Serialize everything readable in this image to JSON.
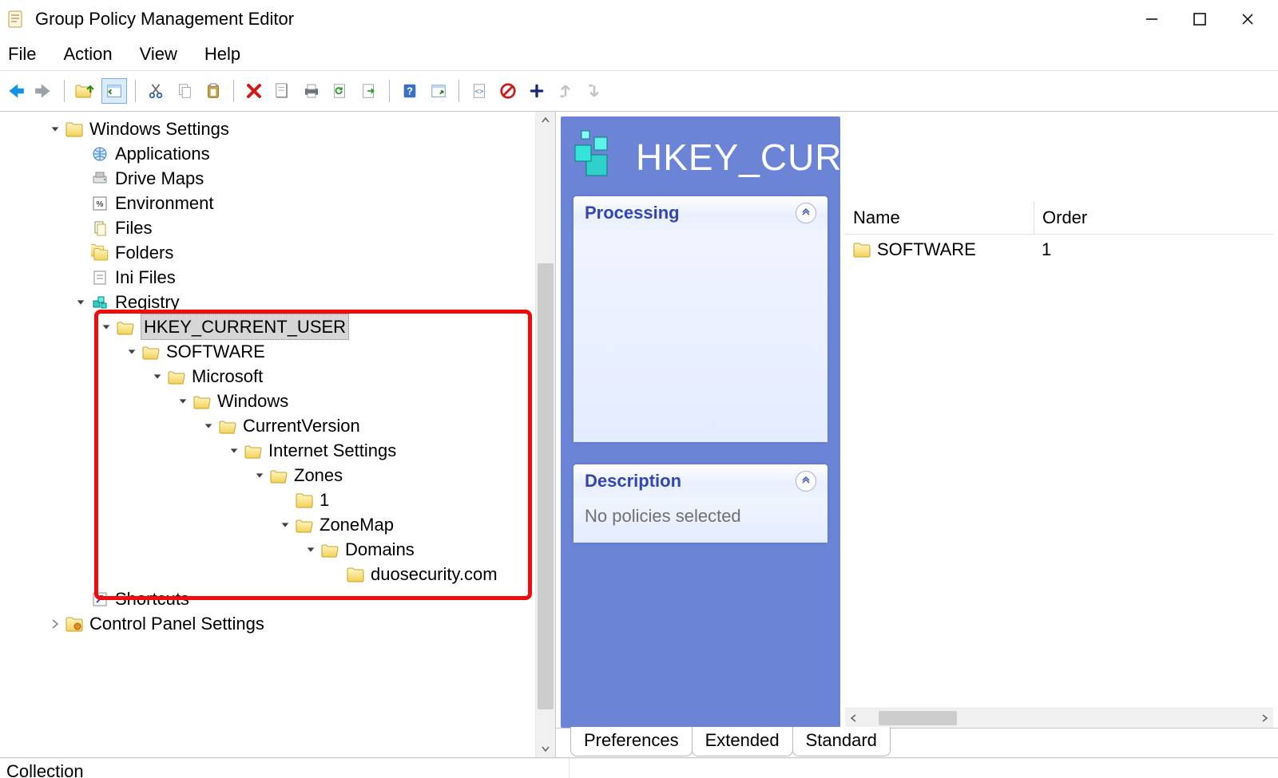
{
  "window": {
    "title": "Group Policy Management Editor"
  },
  "menu": {
    "file": "File",
    "action": "Action",
    "view": "View",
    "help": "Help"
  },
  "toolbar_icons": {
    "back": "back-arrow",
    "forward": "forward-arrow",
    "up": "folder-up",
    "show": "show-pane",
    "cut": "cut",
    "copy": "copy",
    "paste": "paste",
    "delete": "delete-x",
    "properties": "properties",
    "print": "print",
    "refresh": "refresh",
    "export": "export",
    "help": "help",
    "details": "details",
    "code": "code-sheet",
    "stop": "no-entry",
    "plus": "plus",
    "undo": "undo-arrow",
    "redo": "redo-arrow"
  },
  "tree": {
    "s0": "Windows Settings",
    "s1": "Applications",
    "s2": "Drive Maps",
    "s3": "Environment",
    "s4": "Files",
    "s5": "Folders",
    "s6": "Ini Files",
    "s7": "Registry",
    "s8": "HKEY_CURRENT_USER",
    "s9": "SOFTWARE",
    "s10": "Microsoft",
    "s11": "Windows",
    "s12": "CurrentVersion",
    "s13": "Internet Settings",
    "s14": "Zones",
    "s15": "1",
    "s16": "ZoneMap",
    "s17": "Domains",
    "s18": "duosecurity.com",
    "s19": "Shortcuts",
    "s20": "Control Panel Settings"
  },
  "right": {
    "banner_title": "HKEY_CURRENT_USER",
    "cards": {
      "processing": {
        "title": "Processing"
      },
      "description": {
        "title": "Description",
        "body": "No policies selected"
      }
    },
    "list": {
      "columns": {
        "name": "Name",
        "order": "Order"
      },
      "rows": [
        {
          "name": "SOFTWARE",
          "order": "1"
        }
      ]
    }
  },
  "tabs": {
    "preferences": "Preferences",
    "extended": "Extended",
    "standard": "Standard"
  },
  "statusbar": {
    "text": "Collection"
  }
}
